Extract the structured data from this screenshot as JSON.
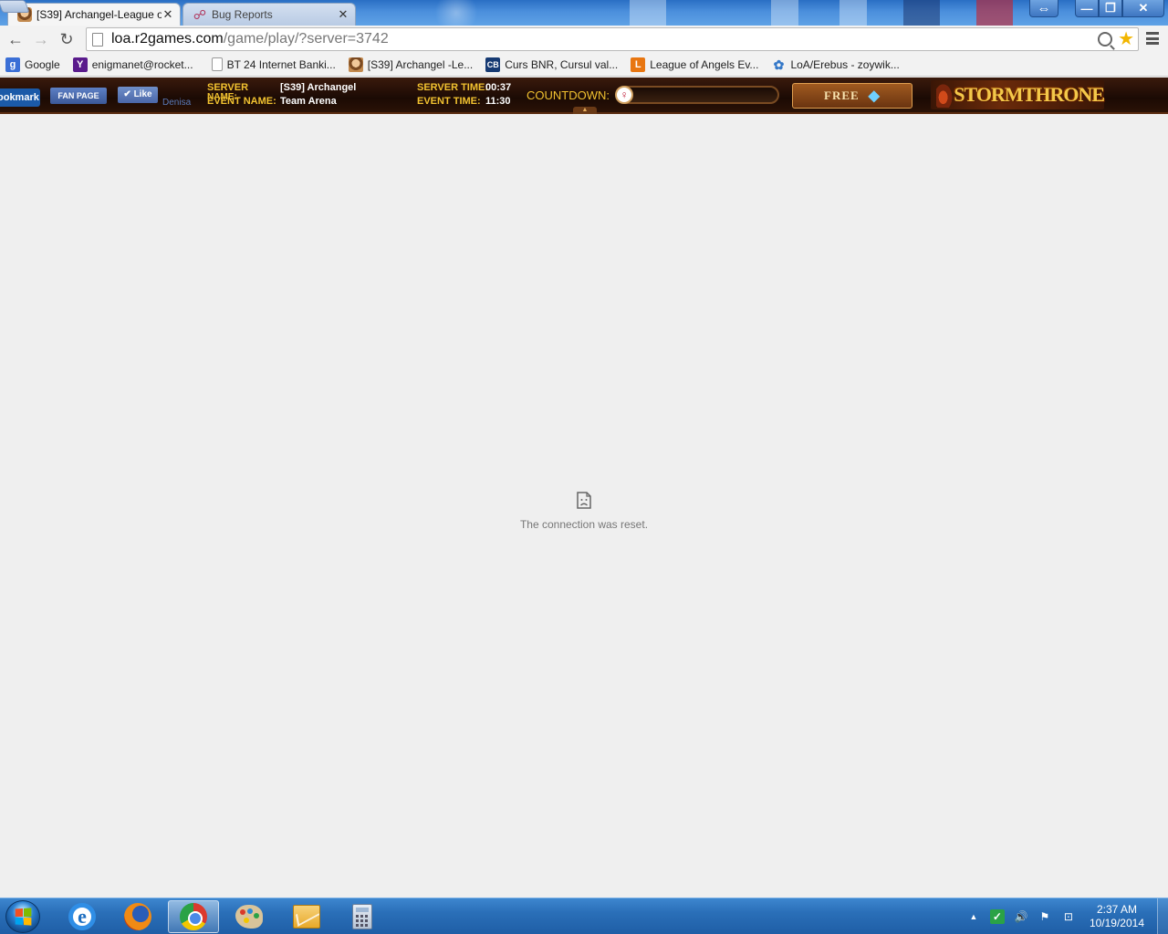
{
  "browser": {
    "tabs": [
      {
        "title": "[S39] Archangel-League o",
        "active": true,
        "icon": "angel-favicon-icon"
      },
      {
        "title": "Bug Reports",
        "active": false,
        "icon": "bug-favicon-icon"
      }
    ],
    "window_controls": {
      "resize": "⇔",
      "minimize": "—",
      "maximize": "❐",
      "close": "✕"
    },
    "url_host": "loa.r2games.com",
    "url_path": "/game/play/?server=3742",
    "bookmarks": [
      {
        "label": "Google",
        "icon": "google-icon",
        "glyph": "g"
      },
      {
        "label": "enigmanet@rocket...",
        "icon": "yahoo-icon",
        "glyph": "Y"
      },
      {
        "label": "BT 24 Internet Banki...",
        "icon": "page-icon",
        "glyph": ""
      },
      {
        "label": "[S39] Archangel -Le...",
        "icon": "angel-favicon-icon",
        "glyph": ""
      },
      {
        "label": "Curs BNR, Cursul val...",
        "icon": "cb-icon",
        "glyph": "CB"
      },
      {
        "label": "League of Angels Ev...",
        "icon": "loa-icon",
        "glyph": "L"
      },
      {
        "label": "LoA/Erebus - zoywik...",
        "icon": "erebus-icon",
        "glyph": "✿"
      }
    ]
  },
  "game_bar": {
    "bookmark_label": "ookmark",
    "fan_page_label": "FAN PAGE",
    "like_label": "✔ Like",
    "like_user": "Denisa",
    "server_name_label_1": "SERVER",
    "server_name_label_2": "NAME:",
    "server_name_value": "[S39] Archangel",
    "event_name_label": "EVENT NAME:",
    "event_name_value": "Team Arena",
    "server_time_label": "SERVER TIME:",
    "server_time_value": "00:37",
    "event_time_label": "EVENT TIME:",
    "event_time_value": "11:30",
    "countdown_label": "COUNTDOWN:",
    "free_label": "FREE",
    "storm_label": "STORMTHRONE"
  },
  "content": {
    "error_message": "The connection was reset."
  },
  "taskbar": {
    "apps": [
      {
        "name": "internet-explorer-icon",
        "active": false
      },
      {
        "name": "firefox-icon",
        "active": false
      },
      {
        "name": "chrome-icon",
        "active": true
      },
      {
        "name": "paint-icon",
        "active": false
      },
      {
        "name": "outlook-icon",
        "active": false
      },
      {
        "name": "calculator-icon",
        "active": false
      }
    ],
    "tray_arrow": "▲",
    "tray_volume": "🔊",
    "tray_flag": "⚑",
    "tray_network": "⊡",
    "clock_time": "2:37 AM",
    "clock_date": "10/19/2014"
  }
}
